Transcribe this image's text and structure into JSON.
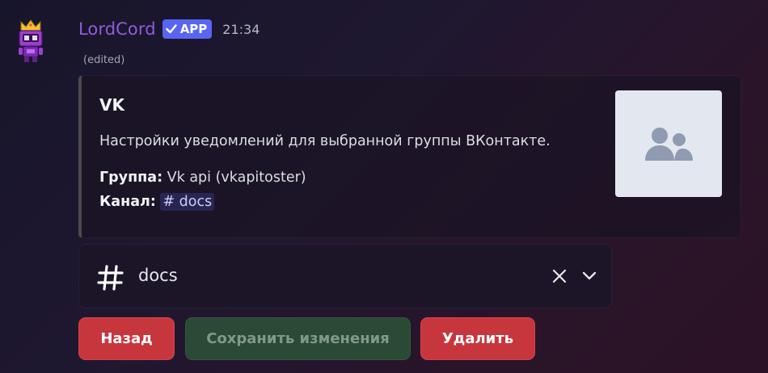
{
  "message": {
    "username": "LordCord",
    "app_badge": "APP",
    "timestamp": "21:34",
    "edited": "(edited)"
  },
  "embed": {
    "title": "VK",
    "description": "Настройки уведомлений для выбранной группы ВКонтакте.",
    "fields": [
      {
        "name": "Группа:",
        "value": "Vk api (vkapitoster)"
      },
      {
        "name": "Канал:",
        "value": "# docs"
      }
    ],
    "thumbnail_icon": "group-users-icon"
  },
  "channel_select": {
    "value": "docs",
    "icon": "hash-icon"
  },
  "buttons": {
    "back": "Назад",
    "save": "Сохранить изменения",
    "delete": "Удалить"
  },
  "colors": {
    "username": "#8f5cd6",
    "badge": "#5865f2",
    "danger": "#c8363d",
    "success_disabled": "#2a4a35"
  }
}
